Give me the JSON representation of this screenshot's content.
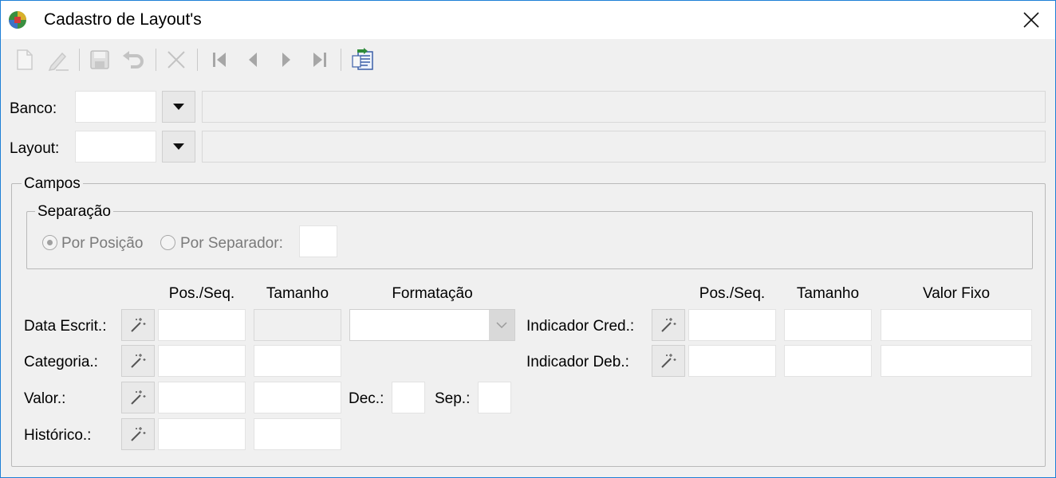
{
  "window": {
    "title": "Cadastro de Layout's"
  },
  "toolbar": {
    "buttons": [
      {
        "name": "new-icon",
        "enabled": false
      },
      {
        "name": "edit-icon",
        "enabled": false
      },
      {
        "name": "save-icon",
        "enabled": false
      },
      {
        "name": "undo-icon",
        "enabled": false
      },
      {
        "name": "delete-icon",
        "enabled": false
      },
      {
        "name": "first-record-icon",
        "enabled": false
      },
      {
        "name": "previous-record-icon",
        "enabled": false
      },
      {
        "name": "next-record-icon",
        "enabled": false
      },
      {
        "name": "last-record-icon",
        "enabled": false
      },
      {
        "name": "import-export-icon",
        "enabled": true
      }
    ]
  },
  "form": {
    "banco_label": "Banco:",
    "layout_label": "Layout:"
  },
  "campos": {
    "title": "Campos",
    "separacao": {
      "title": "Separação",
      "por_posicao": "Por Posição",
      "por_separador": "Por Separador:",
      "selected": "Por Posição"
    },
    "headers_left": {
      "pos_seq": "Pos./Seq.",
      "tamanho": "Tamanho",
      "formatacao": "Formatação"
    },
    "headers_right": {
      "pos_seq": "Pos./Seq.",
      "tamanho": "Tamanho",
      "valor_fixo": "Valor Fixo"
    },
    "rows_left": [
      "Data Escrit.:",
      "Categoria.:",
      "Valor.:",
      "Histórico.:"
    ],
    "rows_right": [
      "Indicador Cred.:",
      "Indicador Deb.:"
    ],
    "dec_label": "Dec.:",
    "sep_label": "Sep.:"
  },
  "colors": {
    "window_border": "#1e7fd6",
    "form_bg": "#f0f0f0",
    "accent_green": "#2e8b3a"
  }
}
